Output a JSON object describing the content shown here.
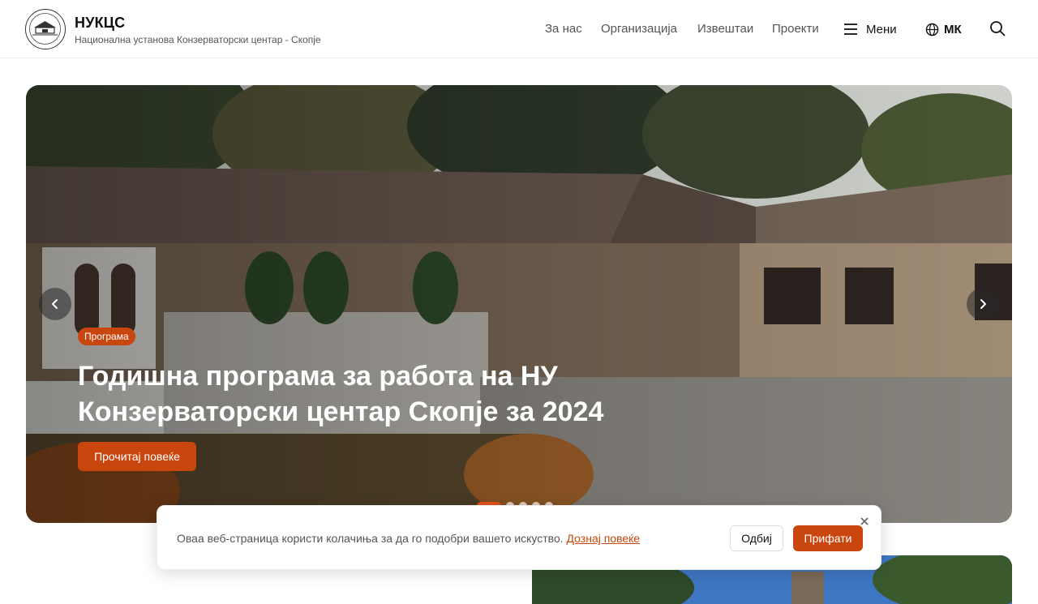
{
  "header": {
    "brand_name": "НУКЦС",
    "brand_sub": "Национална установа Конзерваторски центар - Скопје",
    "nav": [
      "За нас",
      "Организација",
      "Извештаи",
      "Проекти"
    ],
    "menu_label": "Мени",
    "lang_label": "МК",
    "icons": {
      "menu": "hamburger-icon",
      "lang": "globe-icon",
      "search": "search-icon"
    }
  },
  "hero": {
    "badge": "Програма",
    "title": "Годишна програма за работа на НУ Конзерваторски центар Скопје за 2024",
    "read_more": "Прочитај повеќе",
    "slide_count": 5,
    "active_slide": 1
  },
  "cookie": {
    "text": "Оваа веб-страница користи колачиња за да го подобри вашето искуство.",
    "link": "Дознај повеќе",
    "decline": "Одбиј",
    "accept": "Прифати"
  },
  "colors": {
    "accent": "#c9470e",
    "header_border": "#ececec"
  }
}
